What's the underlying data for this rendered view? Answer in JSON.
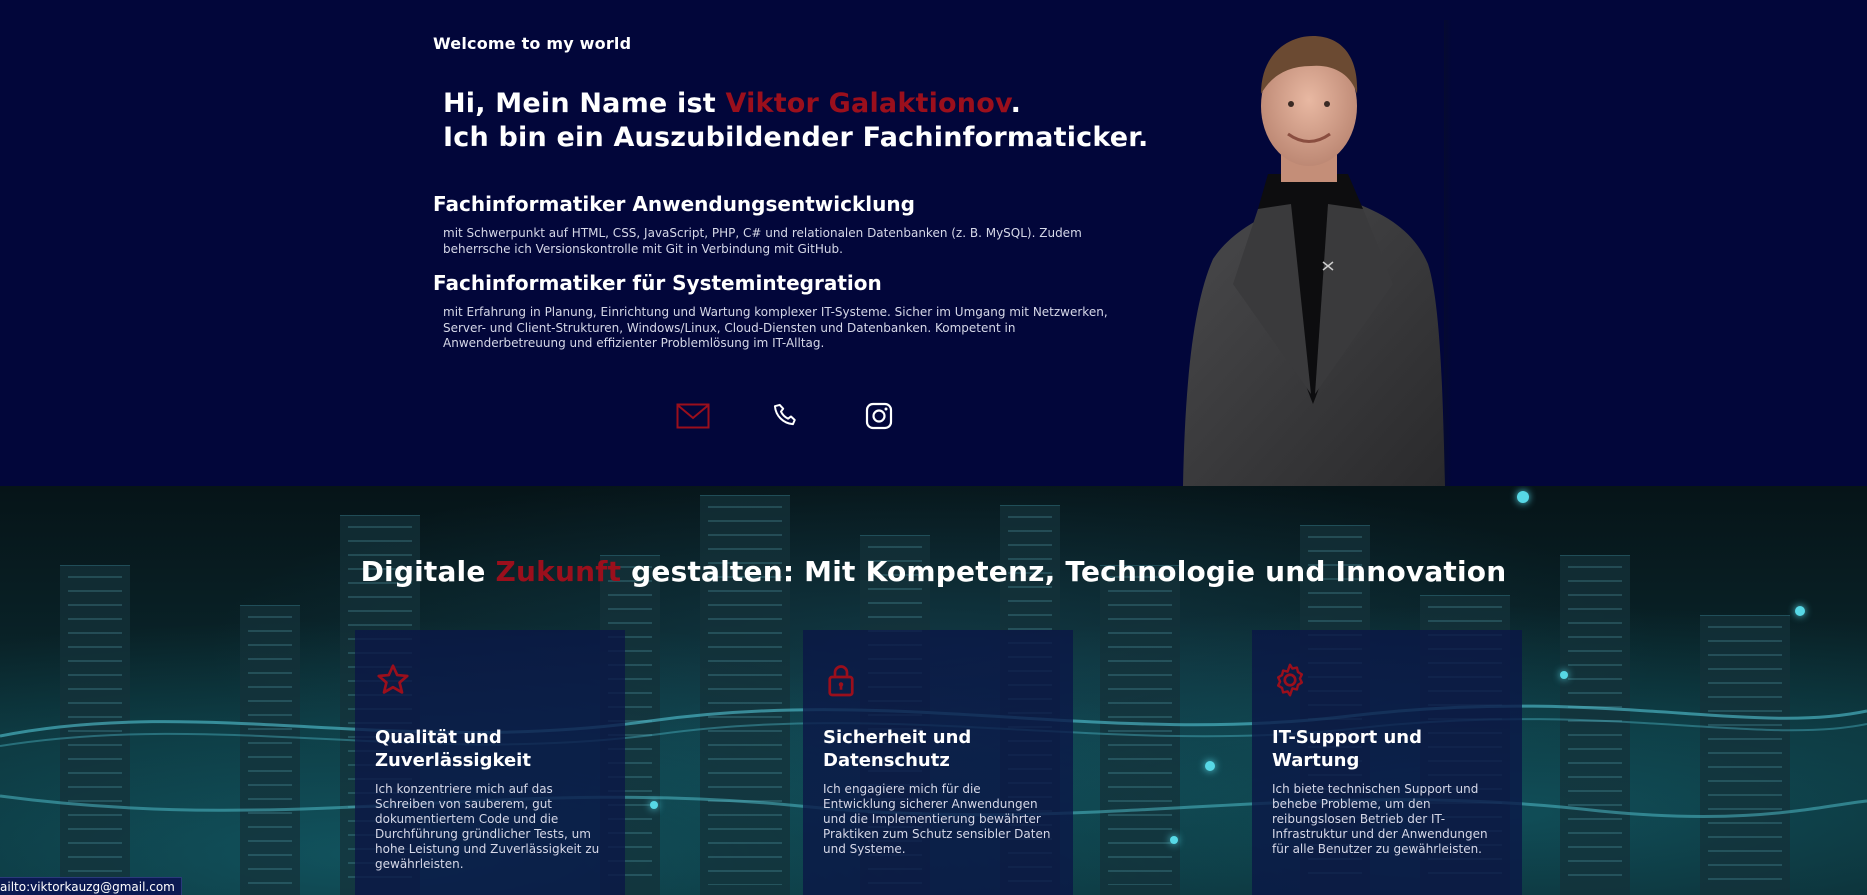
{
  "hero": {
    "welcome": "Welcome to my world",
    "headline_prefix": "Hi, Mein Name ist ",
    "name": "Viktor Galaktionov",
    "headline_dot": ".",
    "headline_line2": "Ich bin ein Auszubildender Fachinformaticker.",
    "roles": [
      {
        "title": "Fachinformatiker Anwendungsentwicklung",
        "text_line1": "mit Schwerpunkt auf HTML, CSS, JavaScript, PHP, C# und relationalen Datenbanken (z. B. MySQL). Zudem",
        "text_line2": "beherrsche ich Versionskontrolle mit Git in Verbindung mit GitHub."
      },
      {
        "title": "Fachinformatiker für Systemintegration",
        "text_line1": "mit Erfahrung in Planung, Einrichtung und Wartung komplexer IT-Systeme. Sicher im Umgang mit Netzwerken,",
        "text_line2": "Server- und Client-Strukturen, Windows/Linux, Cloud-Diensten und Datenbanken. Kompetent in",
        "text_line3": "Anwenderbetreuung und effizienter Problemlösung im IT-Alltag."
      }
    ],
    "contact_icons": [
      "mail-icon",
      "phone-icon",
      "instagram-icon"
    ]
  },
  "services": {
    "title_prefix": "Digitale ",
    "title_accent": "Zukunft",
    "title_suffix": " gestalten: Mit Kompetenz, Technologie und Innovation",
    "cards": [
      {
        "icon": "star-icon",
        "title_line1": "Qualität und",
        "title_line2": "Zuverlässigkeit",
        "text_lines": [
          "Ich konzentriere mich auf das",
          "Schreiben von sauberem, gut",
          "dokumentiertem Code und die",
          "Durchführung gründlicher Tests, um",
          "hohe Leistung und Zuverlässigkeit zu",
          "gewährleisten."
        ]
      },
      {
        "icon": "lock-icon",
        "title_line1": "Sicherheit und",
        "title_line2": "Datenschutz",
        "text_lines": [
          "Ich engagiere mich für die",
          "Entwicklung sicherer Anwendungen",
          "und die Implementierung bewährter",
          "Praktiken zum Schutz sensibler Daten",
          "und Systeme."
        ]
      },
      {
        "icon": "gear-icon",
        "title_line1": "IT-Support und",
        "title_line2": "Wartung",
        "text_lines": [
          "Ich biete technischen Support und",
          "behebe Probleme, um den",
          "reibungslosen Betrieb der IT-",
          "Infrastruktur und der Anwendungen",
          "für alle Benutzer zu gewährleisten."
        ]
      }
    ]
  },
  "statusbar": {
    "url": "ailto:viktorkauzg@gmail.com"
  },
  "colors": {
    "accent": "#9b0f1c",
    "hero_bg": "#02063a",
    "card_bg": "#0a1646"
  }
}
